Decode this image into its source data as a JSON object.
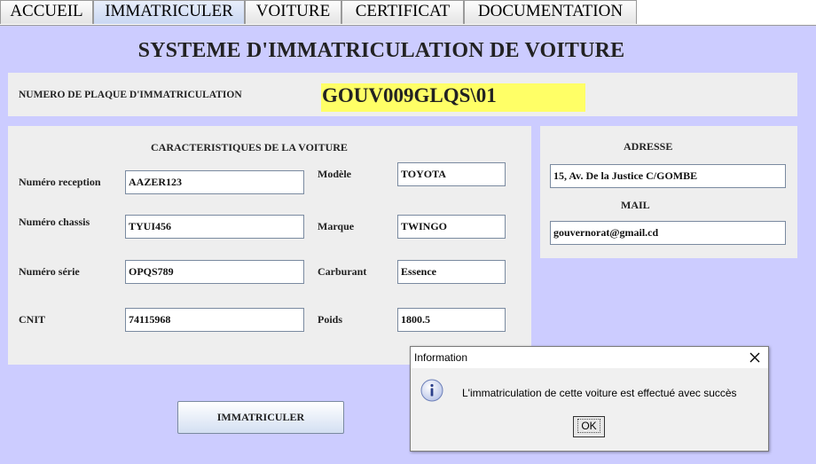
{
  "tabs": [
    {
      "label": "ACCUEIL",
      "active": false
    },
    {
      "label": "IMMATRICULER",
      "active": true
    },
    {
      "label": "VOITURE",
      "active": false
    },
    {
      "label": "CERTIFICAT",
      "active": false
    },
    {
      "label": "DOCUMENTATION",
      "active": false
    }
  ],
  "title": "SYSTEME D'IMMATRICULATION DE VOITURE",
  "plate": {
    "label": "NUMERO DE PLAQUE D'IMMATRICULATION",
    "value": "GOUV009GLQS\\01"
  },
  "characteristics": {
    "heading": "CARACTERISTIQUES DE LA VOITURE",
    "numero_reception": {
      "label": "Numéro reception",
      "value": "AAZER123"
    },
    "numero_chassis": {
      "label": "Numéro chassis",
      "value": "TYUI456"
    },
    "numero_serie": {
      "label": "Numéro série",
      "value": "OPQS789"
    },
    "cnit": {
      "label": "CNIT",
      "value": "74115968"
    },
    "modele": {
      "label": "Modèle",
      "value": "TOYOTA"
    },
    "marque": {
      "label": "Marque",
      "value": "TWINGO"
    },
    "carburant": {
      "label": "Carburant",
      "value": "Essence"
    },
    "poids": {
      "label": "Poids",
      "value": "1800.5"
    }
  },
  "contact": {
    "adresse_label": "ADRESSE",
    "adresse_value": "15, Av. De la Justice C/GOMBE",
    "mail_label": "MAIL",
    "mail_value": "gouvernorat@gmail.cd"
  },
  "button": {
    "label": "IMMATRICULER"
  },
  "dialog": {
    "title": "Information",
    "message": "L'immatriculation de cette voiture est effectué avec succès",
    "ok_label": "OK",
    "icon": "info-icon"
  },
  "colors": {
    "background": "#ccccff",
    "panel": "#eeeeee",
    "plate_highlight": "#ffff66"
  }
}
